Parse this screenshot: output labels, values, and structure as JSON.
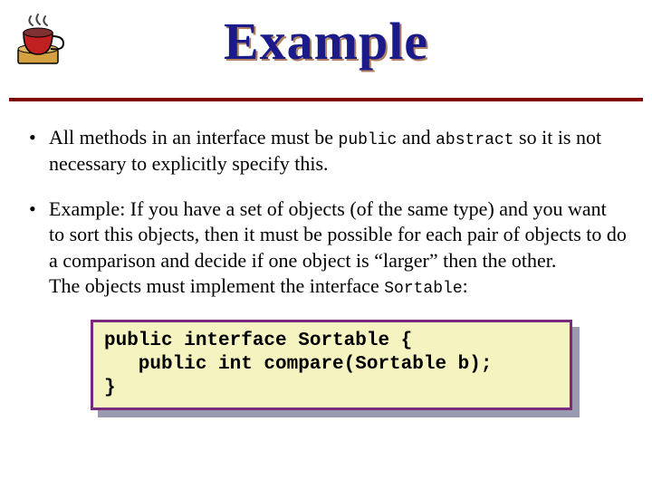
{
  "title": "Example",
  "bullets": [
    {
      "pre1": "All methods in an interface must be ",
      "code1": "public",
      "mid1": " and ",
      "code2": "abstract",
      "post1": " so it is not necessary to explicitly specify this."
    },
    {
      "text": "Example: If you have a set of objects (of the same type) and you want to sort this objects, then it must be possible for each pair of objects to do a comparison and decide if one object is “larger” then the other.\nThe objects must implement the interface ",
      "code": "Sortable",
      "post": ":"
    }
  ],
  "code_block": "public interface Sortable {\n   public int compare(Sortable b);\n}"
}
